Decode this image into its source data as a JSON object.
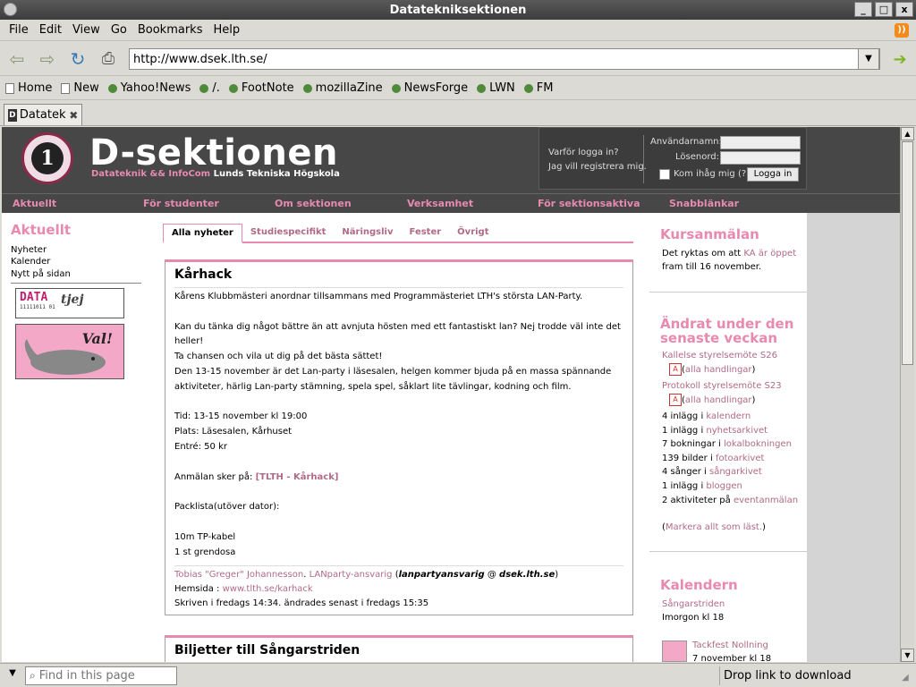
{
  "window": {
    "title": "Datatekniksektionen",
    "controls": [
      "_",
      "□",
      "x"
    ]
  },
  "menu": {
    "items": [
      {
        "label": "File"
      },
      {
        "label": "Edit"
      },
      {
        "label": "View"
      },
      {
        "label": "Go"
      },
      {
        "label": "Bookmarks"
      },
      {
        "label": "Help"
      }
    ]
  },
  "navbar": {
    "url": "http://www.dsek.lth.se/"
  },
  "bookmarks": {
    "items": [
      {
        "label": "Home"
      },
      {
        "label": "New"
      },
      {
        "label": "Yahoo!News"
      },
      {
        "label": "/."
      },
      {
        "label": "FootNote"
      },
      {
        "label": "mozillaZine"
      },
      {
        "label": "NewsForge"
      },
      {
        "label": "LWN"
      },
      {
        "label": "FM"
      }
    ]
  },
  "tab": {
    "label": "Datatek"
  },
  "site": {
    "title": "D-sektionen",
    "sub_pink": "Datateknik && InfoCom",
    "sub_white": "Lunds Tekniska Högskola",
    "login": {
      "why": "Varför logga in?",
      "register": "Jag vill registrera mig.",
      "user_label": "Användarnamn:",
      "pass_label": "Lösenord:",
      "remember": "Kom ihåg mig",
      "help": "(?)",
      "button": "Logga in"
    },
    "nav": [
      "Aktuellt",
      "För studenter",
      "Om sektionen",
      "Verksamhet",
      "För sektionsaktiva",
      "Snabblänkar"
    ]
  },
  "left": {
    "heading": "Aktuellt",
    "links": [
      "Nyheter",
      "Kalender",
      "Nytt på sidan"
    ],
    "datatjej_logo": "DATA",
    "datatjej_word": "tjej",
    "datatjej_bits": "11111011 01",
    "val_text": "Val!"
  },
  "main": {
    "tabs": [
      "Alla nyheter",
      "Studiespecifikt",
      "Näringsliv",
      "Fester",
      "Övrigt"
    ],
    "article1": {
      "title": "Kårhack",
      "p1": "Kårens Klubbmästeri anordnar tillsammans med Programmästeriet LTH's största LAN-Party.",
      "p2a": "Kan du tänka dig något bättre än att avnjuta hösten med ett fantastiskt lan? Nej trodde väl inte det heller!",
      "p2b": "Ta chansen och vila ut dig på det bästa sättet!",
      "p2c": "Den 13-15 november är det Lan-party i läsesalen, helgen kommer bjuda på en massa spännande aktiviteter, härlig Lan-party stämning, spela spel, såklart lite tävlingar, kodning och film.",
      "time": "Tid: 13-15 november kl 19:00",
      "place": "Plats: Läsesalen, Kårhuset",
      "fee": "Entré: 50 kr",
      "signup_pre": "Anmälan sker på:",
      "signup_link": "[TLTH - Kårhack]",
      "packlist": "Packlista(utöver dator):",
      "item1": "10m TP-kabel",
      "item2": "1 st grendosa",
      "author": "Tobias \"Greger\" Johannesson",
      "role": "LANparty-ansvarig",
      "email_user": "lanpartyansvarig",
      "email_at": "@",
      "email_domain": "dsek.lth.se",
      "homepage_label": "Hemsida :",
      "homepage": "www.tlth.se/karhack",
      "written": "Skriven i fredags 14:34. ändrades senast i fredags 15:35"
    },
    "article2": {
      "title": "Biljetter till Sångarstriden"
    }
  },
  "right": {
    "kurs_heading": "Kursanmälan",
    "kurs_pre": "Det ryktas om att",
    "kurs_link": "KA är öppet",
    "kurs_post": "fram till 16 november.",
    "changed_heading": "Ändrat under den senaste veckan",
    "doc1": "Kallelse styrelsemöte S26",
    "doc2": "Protokoll styrelsemöte S23",
    "all_docs": "alla handlingar",
    "stats": [
      {
        "pre": "4 inlägg i",
        "link": "kalendern"
      },
      {
        "pre": "1 inlägg i",
        "link": "nyhetsarkivet"
      },
      {
        "pre": "7 bokningar i",
        "link": "lokalbokningen"
      },
      {
        "pre": "139 bilder i",
        "link": "fotoarkivet"
      },
      {
        "pre": "4 sånger i",
        "link": "sångarkivet"
      },
      {
        "pre": "1 inlägg i",
        "link": "bloggen"
      },
      {
        "pre": "2 aktiviteter på",
        "link": "eventanmälan"
      }
    ],
    "mark_read": "Markera allt som läst.",
    "cal_heading": "Kalendern",
    "cal1_title": "Sångarstriden",
    "cal1_time": "Imorgon kl 18",
    "cal2_title": "Tackfest Nollning",
    "cal2_time": "7 november kl 18"
  },
  "statusbar": {
    "find_placeholder": "Find in this page",
    "status": "Drop link to download"
  }
}
